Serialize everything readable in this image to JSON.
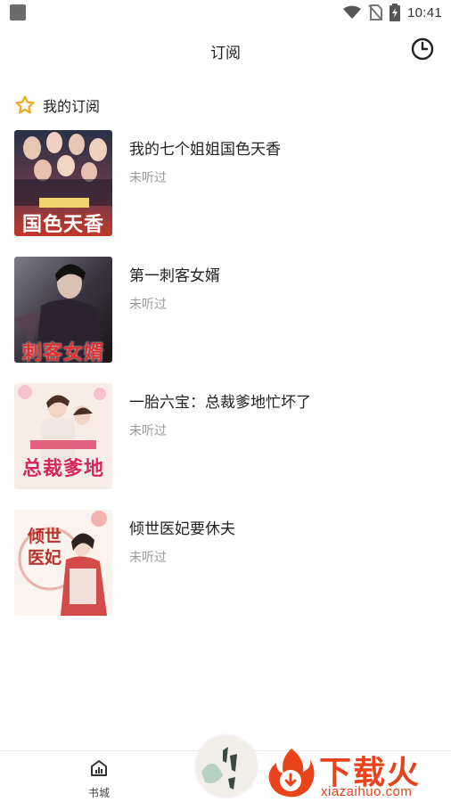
{
  "status_bar": {
    "time": "10:41",
    "icons": [
      "notification-icon",
      "wifi-icon",
      "no-sim-icon",
      "battery-icon"
    ]
  },
  "app_bar": {
    "title": "订阅",
    "history_icon": "clock-icon"
  },
  "section": {
    "title": "我的订阅",
    "icon": "star-icon",
    "accent": "#f5a623"
  },
  "books": [
    {
      "title": "我的七个姐姐国色天香",
      "status": "未听过",
      "cover_text": "国色天香"
    },
    {
      "title": "第一刺客女婿",
      "status": "未听过",
      "cover_text": "刺客女婿"
    },
    {
      "title": "一胎六宝：总裁爹地忙坏了",
      "status": "未听过",
      "cover_text": "总裁爹地"
    },
    {
      "title": "倾世医妃要休夫",
      "status": "未听过",
      "cover_text": "倾世医妃"
    }
  ],
  "bottom_nav": {
    "store_label": "书城",
    "store_icon": "bookstore-icon"
  },
  "watermark": {
    "text": "下载火",
    "url": "xiazaihuo.com",
    "color": "#e8431a"
  }
}
